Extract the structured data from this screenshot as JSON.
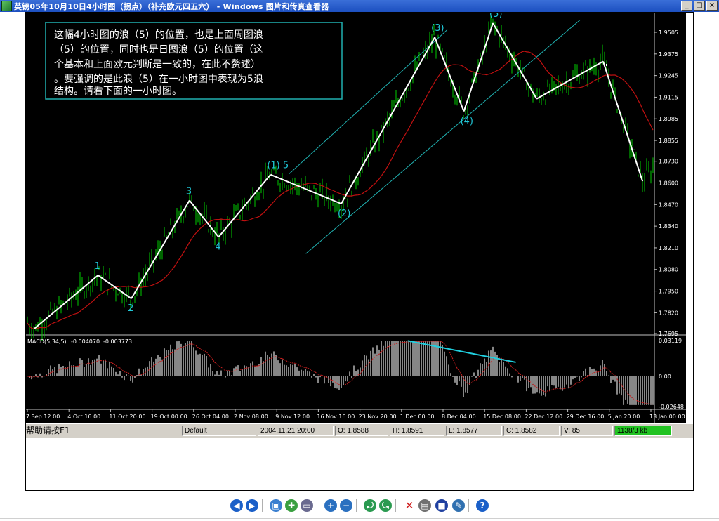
{
  "window": {
    "title": "英镑05年10月10日4小时图（拐点）（补充欧元四五六） - Windows 图片和传真查看器",
    "minimize_label": "_",
    "maximize_label": "□",
    "close_label": "×"
  },
  "chart_data": {
    "type": "line",
    "annotation_text": [
      "这幅4小时图的浪（5）的位置，也是上面周图浪",
      "（5）的位置，同时也是日图浪（5）的位置（这",
      "个基本和上面欧元判断是一致的，在此不赘述）",
      "。要强调的是此浪（5）在一小时图中表现为5浪",
      "结构。请看下面的一小时图。"
    ],
    "y_axis_ticks": [
      "1.9505",
      "1.9375",
      "1.9245",
      "1.9115",
      "1.8985",
      "1.8855",
      "1.8730",
      "1.8600",
      "1.8470",
      "1.8340",
      "1.8210",
      "1.8080",
      "1.7950",
      "1.7820",
      "1.7695"
    ],
    "ylim": [
      1.7695,
      1.9505
    ],
    "x_axis_ticks": [
      "7 Sep 12:00",
      "4 Oct 16:00",
      "11 Oct 20:00",
      "19 Oct 00:00",
      "26 Oct 04:00",
      "2 Nov 08:00",
      "9 Nov 12:00",
      "16 Nov 16:00",
      "23 Nov 20:00",
      "1 Dec 00:00",
      "8 Dec 04:00",
      "15 Dec 08:00",
      "22 Dec 12:00",
      "29 Dec 16:00",
      "5 Jan 20:00",
      "13 Jan 00:00"
    ],
    "wave_points": [
      {
        "label": "",
        "x": 0.17,
        "y": 1.7725
      },
      {
        "label": "1",
        "x": 1.7,
        "y": 1.8045
      },
      {
        "label": "2",
        "x": 2.5,
        "y": 1.7905
      },
      {
        "label": "3",
        "x": 3.9,
        "y": 1.8495
      },
      {
        "label": "4",
        "x": 4.6,
        "y": 1.8275
      },
      {
        "label": "(1) 5",
        "x": 5.85,
        "y": 1.865
      },
      {
        "label": "(2)",
        "x": 7.55,
        "y": 1.8475
      },
      {
        "label": "(3)",
        "x": 9.8,
        "y": 1.9475
      },
      {
        "label": "(4)",
        "x": 10.5,
        "y": 1.903
      },
      {
        "label": "(5)",
        "x": 11.2,
        "y": 1.956
      },
      {
        "label": "",
        "x": 12.25,
        "y": 1.9105
      },
      {
        "label": "",
        "x": 13.85,
        "y": 1.933
      },
      {
        "label": "",
        "x": 14.8,
        "y": 1.861
      }
    ],
    "channel_lines": [
      {
        "x1": 6.3,
        "y1": 1.8655,
        "x2": 10.1,
        "y2": 1.952
      },
      {
        "x1": 6.7,
        "y1": 1.8175,
        "x2": 13.3,
        "y2": 1.958
      }
    ],
    "macd": {
      "label": "MACD(5,34,5)",
      "value1": "-0.004070",
      "value2": "-0.003773",
      "ticks": [
        "0.03119",
        "0.00",
        "-0.02648"
      ],
      "ylim": [
        -0.02648,
        0.03119
      ],
      "divergence_line": {
        "x1": 9.15,
        "y1": 0.031,
        "x2": 11.75,
        "y2": 0.0122
      }
    },
    "colors": {
      "candles": "#00cc00",
      "moving_average": "#c01010",
      "wave_lines": "#ffffff",
      "channel_lines": "#20b0b0",
      "wave_labels": "#20c8d8",
      "macd_histogram": "#c0c0c0",
      "macd_signal": "#d02020",
      "divergence_line": "#20d0e0",
      "text_box_border": "#20b0b0"
    }
  },
  "status_bar": {
    "help_text": "帮助请按F1",
    "profile": "Default",
    "datetime": "2004.11.21 20:00",
    "open": "O: 1.8588",
    "high": "H: 1.8591",
    "low": "L: 1.8577",
    "close": "C: 1.8582",
    "volume": "V: 85",
    "traffic": "1138/3 kb"
  },
  "toolbar": {
    "buttons": [
      {
        "name": "previous-image-button",
        "icon": "prev-icon",
        "color": "#1a5fc8"
      },
      {
        "name": "next-image-button",
        "icon": "next-icon",
        "color": "#1a5fc8"
      },
      {
        "name": "best-fit-button",
        "icon": "best-fit-icon",
        "color": "#3a7fd0"
      },
      {
        "name": "actual-size-button",
        "icon": "actual-size-icon",
        "color": "#3aa040"
      },
      {
        "name": "slideshow-button",
        "icon": "slideshow-icon",
        "color": "#6a6a90"
      },
      {
        "name": "zoom-in-button",
        "icon": "zoom-in-icon",
        "color": "#2a70c0"
      },
      {
        "name": "zoom-out-button",
        "icon": "zoom-out-icon",
        "color": "#2a70c0"
      },
      {
        "name": "rotate-clockwise-button",
        "icon": "rotate-cw-icon",
        "color": "#2a9a50"
      },
      {
        "name": "rotate-counterclockwise-button",
        "icon": "rotate-ccw-icon",
        "color": "#2a9a50"
      },
      {
        "name": "delete-button",
        "icon": "delete-icon",
        "color": "#d02020"
      },
      {
        "name": "print-button",
        "icon": "print-icon",
        "color": "#707070"
      },
      {
        "name": "save-button",
        "icon": "save-icon",
        "color": "#2040a0"
      },
      {
        "name": "edit-button",
        "icon": "edit-icon",
        "color": "#3070b0"
      },
      {
        "name": "help-button",
        "icon": "help-icon",
        "color": "#1a5fc8"
      }
    ]
  }
}
